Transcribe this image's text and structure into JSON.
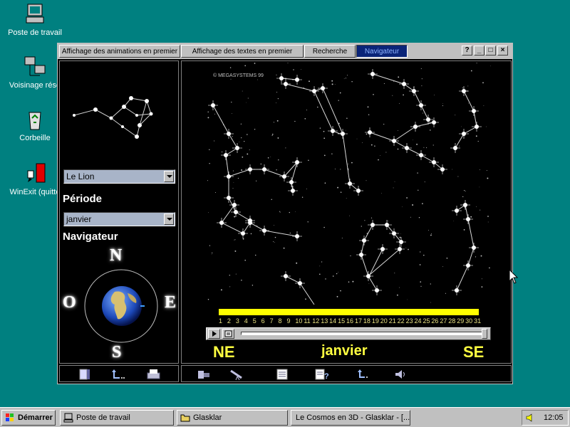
{
  "desktop": {
    "icons": [
      {
        "label": "Poste de travail",
        "icon": "computer-icon"
      },
      {
        "label": "Voisinage rése",
        "icon": "network-icon"
      },
      {
        "label": "Corbeille",
        "icon": "recycle-bin-icon"
      },
      {
        "label": "WinExit (quitte",
        "icon": "exit-icon"
      }
    ]
  },
  "window": {
    "tabs": [
      {
        "label": "Affichage des animations en premier"
      },
      {
        "label": "Affichage des textes en premier"
      },
      {
        "label": "Recherche"
      },
      {
        "label": "Navigateur",
        "active": true
      }
    ],
    "controls": {
      "help": "?",
      "minimize": "_",
      "maximize": "□",
      "close": "×"
    }
  },
  "left": {
    "constellation_select": "Le Lion",
    "period_heading": "Période",
    "period_select": "janvier",
    "navigator_heading": "Navigateur",
    "compass": {
      "north": "N",
      "south": "S",
      "east": "E",
      "west": "O"
    }
  },
  "main": {
    "copyright": "© MEGASYSTEMS 99",
    "timeline_numbers": [
      "1",
      "2",
      "3",
      "4",
      "5",
      "6",
      "7",
      "8",
      "9",
      "10",
      "11",
      "12",
      "13",
      "14",
      "15",
      "16",
      "17",
      "18",
      "19",
      "20",
      "21",
      "22",
      "23",
      "24",
      "25",
      "26",
      "27",
      "28",
      "29",
      "30",
      "31"
    ],
    "direction_left": "NE",
    "current_month": "janvier",
    "direction_right": "SE",
    "timeline_color": "#ffff00",
    "label_color": "#ffff40"
  },
  "toolbar_left": [
    {
      "icon": "exit-door-icon"
    },
    {
      "icon": "back-arrow-icon"
    },
    {
      "icon": "printer-icon"
    }
  ],
  "toolbar_right": [
    {
      "icon": "projector-icon"
    },
    {
      "icon": "telescope-icon"
    },
    {
      "icon": "text-document-icon"
    },
    {
      "icon": "help-document-icon"
    },
    {
      "icon": "back-pointer-icon"
    },
    {
      "icon": "speaker-icon"
    }
  ],
  "taskbar": {
    "start": "Démarrer",
    "buttons": [
      {
        "label": "Poste de travail",
        "icon": "computer-icon"
      },
      {
        "label": "Glasklar",
        "icon": "folder-icon"
      },
      {
        "label": "Le Cosmos en 3D - Glasklar - [...",
        "icon": ""
      }
    ],
    "clock": "12:05"
  }
}
